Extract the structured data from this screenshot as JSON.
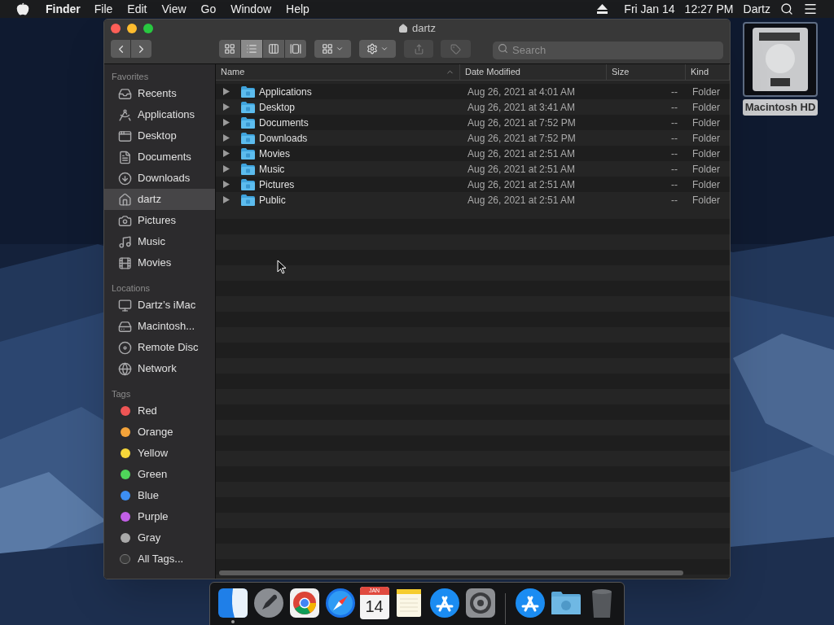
{
  "menu_bar": {
    "app": "Finder",
    "menus": [
      "File",
      "Edit",
      "View",
      "Go",
      "Window",
      "Help"
    ],
    "date": "Fri Jan 14",
    "time": "12:27 PM",
    "user": "Dartz"
  },
  "window": {
    "title": "dartz",
    "search": {
      "placeholder": "Search"
    },
    "view_modes": [
      {
        "kind": "icons",
        "selected": false
      },
      {
        "kind": "list",
        "selected": true
      },
      {
        "kind": "columns",
        "selected": false
      },
      {
        "kind": "gallery",
        "selected": false
      }
    ]
  },
  "sidebar": {
    "sections": [
      {
        "heading": "Favorites",
        "items": [
          {
            "label": "Recents",
            "kind": "recents",
            "selected": false
          },
          {
            "label": "Applications",
            "kind": "applications",
            "selected": false
          },
          {
            "label": "Desktop",
            "kind": "desktop",
            "selected": false
          },
          {
            "label": "Documents",
            "kind": "documents",
            "selected": false
          },
          {
            "label": "Downloads",
            "kind": "downloads",
            "selected": false
          },
          {
            "label": "dartz",
            "kind": "home",
            "selected": true
          },
          {
            "label": "Pictures",
            "kind": "pictures",
            "selected": false
          },
          {
            "label": "Music",
            "kind": "music",
            "selected": false
          },
          {
            "label": "Movies",
            "kind": "movies",
            "selected": false
          }
        ]
      },
      {
        "heading": "Locations",
        "items": [
          {
            "label": "Dartz’s iMac",
            "kind": "computer",
            "selected": false
          },
          {
            "label": "Macintosh...",
            "kind": "disk",
            "selected": false
          },
          {
            "label": "Remote Disc",
            "kind": "disc",
            "selected": false
          },
          {
            "label": "Network",
            "kind": "network",
            "selected": false
          }
        ]
      },
      {
        "heading": "Tags",
        "items": [
          {
            "label": "Red",
            "kind": "tag",
            "color": "#ee5555",
            "selected": false
          },
          {
            "label": "Orange",
            "kind": "tag",
            "color": "#f3a33a",
            "selected": false
          },
          {
            "label": "Yellow",
            "kind": "tag",
            "color": "#f5d63a",
            "selected": false
          },
          {
            "label": "Green",
            "kind": "tag",
            "color": "#4fd55a",
            "selected": false
          },
          {
            "label": "Blue",
            "kind": "tag",
            "color": "#3d8ff3",
            "selected": false
          },
          {
            "label": "Purple",
            "kind": "tag",
            "color": "#c25fe6",
            "selected": false
          },
          {
            "label": "Gray",
            "kind": "tag",
            "color": "#a9a9a9",
            "selected": false
          },
          {
            "label": "All Tags...",
            "kind": "alltags",
            "selected": false
          }
        ]
      }
    ]
  },
  "table": {
    "columns": [
      "Name",
      "Date Modified",
      "Size",
      "Kind"
    ],
    "rows": [
      {
        "name": "Applications",
        "date": "Aug 26, 2021 at 4:01 AM",
        "size": "--",
        "kind": "Folder",
        "expanded": false
      },
      {
        "name": "Desktop",
        "date": "Aug 26, 2021 at 3:41 AM",
        "size": "--",
        "kind": "Folder",
        "expanded": false
      },
      {
        "name": "Documents",
        "date": "Aug 26, 2021 at 7:52 PM",
        "size": "--",
        "kind": "Folder",
        "expanded": false
      },
      {
        "name": "Downloads",
        "date": "Aug 26, 2021 at 7:52 PM",
        "size": "--",
        "kind": "Folder",
        "expanded": false
      },
      {
        "name": "Movies",
        "date": "Aug 26, 2021 at 2:51 AM",
        "size": "--",
        "kind": "Folder",
        "expanded": false
      },
      {
        "name": "Music",
        "date": "Aug 26, 2021 at 2:51 AM",
        "size": "--",
        "kind": "Folder",
        "expanded": false
      },
      {
        "name": "Pictures",
        "date": "Aug 26, 2021 at 2:51 AM",
        "size": "--",
        "kind": "Folder",
        "expanded": false
      },
      {
        "name": "Public",
        "date": "Aug 26, 2021 at 2:51 AM",
        "size": "--",
        "kind": "Folder",
        "expanded": false
      }
    ]
  },
  "desktop_icons": [
    {
      "label": "Macintosh HD",
      "selected": true
    }
  ],
  "dock": {
    "items": [
      {
        "kind": "finder",
        "running": true
      },
      {
        "kind": "launchpad",
        "running": false
      },
      {
        "kind": "chrome",
        "running": false
      },
      {
        "kind": "safari",
        "running": false
      },
      {
        "kind": "calendar",
        "month": "JAN",
        "day": "14",
        "running": false
      },
      {
        "kind": "notes",
        "running": false
      },
      {
        "kind": "appstore",
        "running": false
      },
      {
        "kind": "settings",
        "running": false
      },
      {
        "kind": "separator"
      },
      {
        "kind": "appstore",
        "running": false
      },
      {
        "kind": "downloads",
        "running": false
      },
      {
        "kind": "trash",
        "running": false
      }
    ]
  }
}
